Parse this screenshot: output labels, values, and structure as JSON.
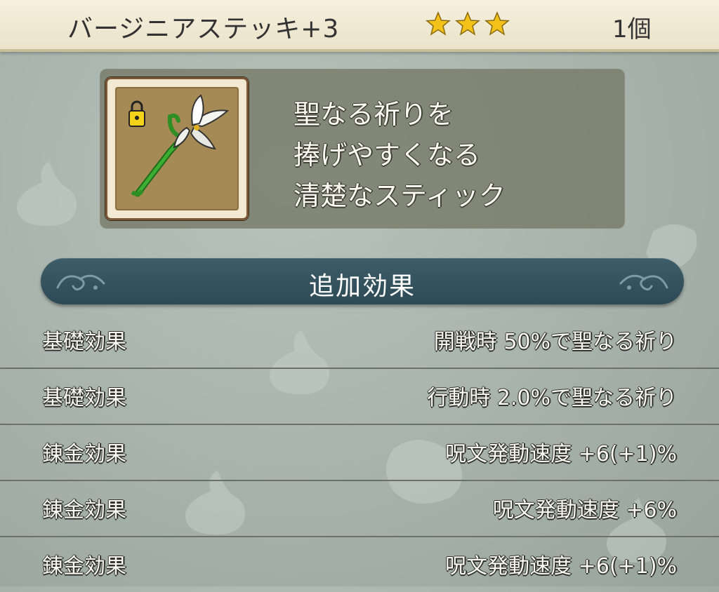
{
  "item": {
    "name": "バージニアステッキ+3",
    "rarity_stars": 3,
    "count": "1個",
    "icon": "lily-staff-icon",
    "description": [
      "聖なる祈りを",
      "捧げやすくなる",
      "清楚なスティック"
    ]
  },
  "section": {
    "title": "追加効果"
  },
  "effects": [
    {
      "label": "基礎効果",
      "value": "開戦時 50%で聖なる祈り"
    },
    {
      "label": "基礎効果",
      "value": "行動時 2.0%で聖なる祈り"
    },
    {
      "label": "錬金効果",
      "value": "呪文発動速度 +6(+1)%"
    },
    {
      "label": "錬金効果",
      "value": "呪文発動速度 +6%"
    },
    {
      "label": "錬金効果",
      "value": "呪文発動速度 +6(+1)%"
    }
  ],
  "colors": {
    "star": "#f2c21a",
    "banner": "#2d4a55",
    "title_bar": "#f4eedb"
  }
}
